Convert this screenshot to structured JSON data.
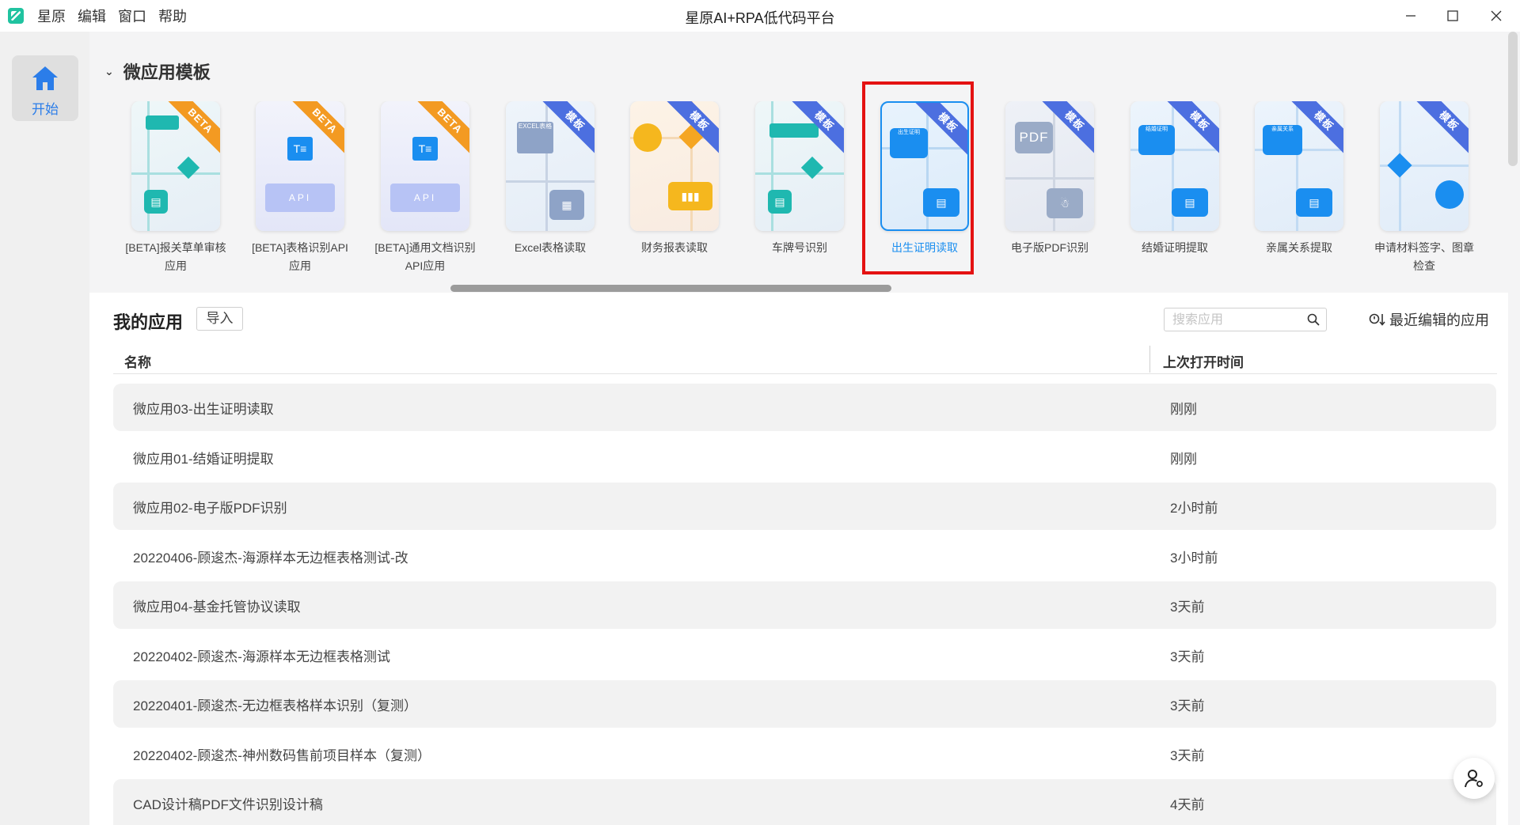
{
  "window": {
    "title": "星原AI+RPA低代码平台",
    "menu": [
      "星原",
      "编辑",
      "窗口",
      "帮助"
    ]
  },
  "sidebar": {
    "start_label": "开始"
  },
  "templates": {
    "section_title": "微应用模板",
    "items": [
      {
        "label": "[BETA]报关草单审核应用",
        "badge": "BETA",
        "icon": "flowchart-icon"
      },
      {
        "label": "[BETA]表格识别API应用",
        "badge": "BETA",
        "icon": "table-api-icon"
      },
      {
        "label": "[BETA]通用文档识别API应用",
        "badge": "BETA",
        "icon": "document-api-icon"
      },
      {
        "label": "Excel表格读取",
        "badge": "模板",
        "icon": "excel-icon"
      },
      {
        "label": "财务报表读取",
        "badge": "模板",
        "icon": "finance-chart-icon"
      },
      {
        "label": "车牌号识别",
        "badge": "模板",
        "icon": "flowchart-icon"
      },
      {
        "label": "出生证明读取",
        "badge": "模板",
        "icon": "birth-certificate-icon",
        "selected": true
      },
      {
        "label": "电子版PDF识别",
        "badge": "模板",
        "icon": "pdf-icon"
      },
      {
        "label": "结婚证明提取",
        "badge": "模板",
        "icon": "marriage-certificate-icon"
      },
      {
        "label": "亲属关系提取",
        "badge": "模板",
        "icon": "relationship-icon"
      },
      {
        "label": "申请材料签字、图章检查",
        "badge": "模板",
        "icon": "signature-check-icon"
      }
    ],
    "pdf_text": "PDF",
    "excel_text": "EXCEL表格",
    "api_text": "API",
    "birth_text": "出生证明",
    "marriage_text": "结婚证明",
    "relation_text": "亲属关系"
  },
  "my_apps": {
    "title": "我的应用",
    "import_label": "导入",
    "search_placeholder": "搜索应用",
    "recent_label": "最近编辑的应用",
    "columns": {
      "name": "名称",
      "last_opened": "上次打开时间"
    },
    "rows": [
      {
        "name": "微应用03-出生证明读取",
        "time": "刚刚"
      },
      {
        "name": "微应用01-结婚证明提取",
        "time": "刚刚"
      },
      {
        "name": "微应用02-电子版PDF识别",
        "time": "2小时前"
      },
      {
        "name": "20220406-顾逡杰-海源样本无边框表格测试-改",
        "time": "3小时前"
      },
      {
        "name": "微应用04-基金托管协议读取",
        "time": "3天前"
      },
      {
        "name": "20220402-顾逡杰-海源样本无边框表格测试",
        "time": "3天前"
      },
      {
        "name": "20220401-顾逡杰-无边框表格样本识别（复测）",
        "time": "3天前"
      },
      {
        "name": "20220402-顾逡杰-神州数码售前项目样本（复测）",
        "time": "3天前"
      },
      {
        "name": "CAD设计稿PDF文件识别设计稿",
        "time": "4天前"
      }
    ]
  },
  "colors": {
    "accent": "#1a8ef0",
    "beta_badge": "#f39a22",
    "template_badge": "#4c6fe0",
    "highlight": "#e41212"
  }
}
